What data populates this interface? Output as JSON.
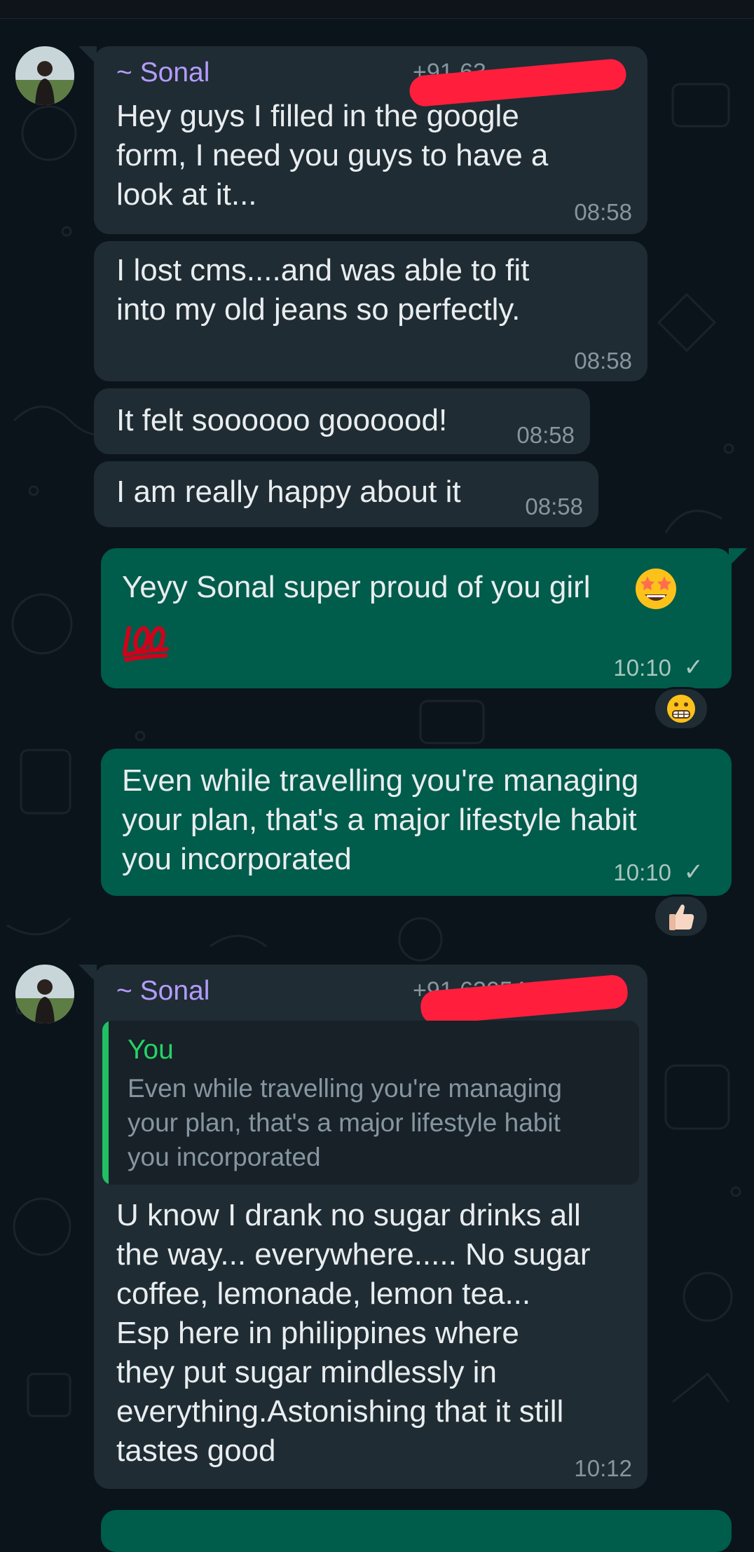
{
  "theme": {
    "background": "#0b141a",
    "incoming_bubble": "#1f2c33",
    "outgoing_bubble": "#005c4b",
    "sender_name_color": "#b49cff",
    "quote_accent": "#25d366",
    "redaction_color": "#ff1f3d"
  },
  "messages": [
    {
      "sender": "~ Sonal",
      "phone_prefix": "+91 63",
      "lines": [
        "Hey guys I filled in the google",
        "form, I need you guys to have a",
        "look at it..."
      ],
      "time": "08:58"
    },
    {
      "lines": [
        "I lost cms....and was able to fit",
        "into my old jeans so perfectly."
      ],
      "time": "08:58"
    },
    {
      "lines": [
        "It felt soooooo goooood!"
      ],
      "time": "08:58"
    },
    {
      "lines": [
        "I am really happy about it"
      ],
      "time": "08:58"
    },
    {
      "lines": [
        "Yeyy Sonal super proud of you girl"
      ],
      "emoji_inline": "star-struck-emoji",
      "emoji_next_line": "hundred-points-emoji",
      "time": "10:10",
      "status": "✓",
      "reaction": "grimacing-face-emoji"
    },
    {
      "lines": [
        "Even while travelling you're managing",
        "your plan, that's a major lifestyle habit",
        "you incorporated"
      ],
      "time": "10:10",
      "status": "✓",
      "reaction": "thumbs-up-emoji"
    },
    {
      "sender": "~ Sonal",
      "phone_prefix": "+91 63054 7",
      "quote": {
        "author": "You",
        "lines": [
          "Even while travelling you're managing",
          "your plan, that's a major lifestyle habit",
          "you incorporated"
        ]
      },
      "lines": [
        "U know I drank no sugar drinks all",
        "the way... everywhere..... No sugar",
        "coffee, lemonade, lemon tea...",
        "Esp here in philippines where",
        "they put sugar mindlessly in",
        "everything.Astonishing that it still",
        "tastes good"
      ],
      "time": "10:12"
    }
  ]
}
